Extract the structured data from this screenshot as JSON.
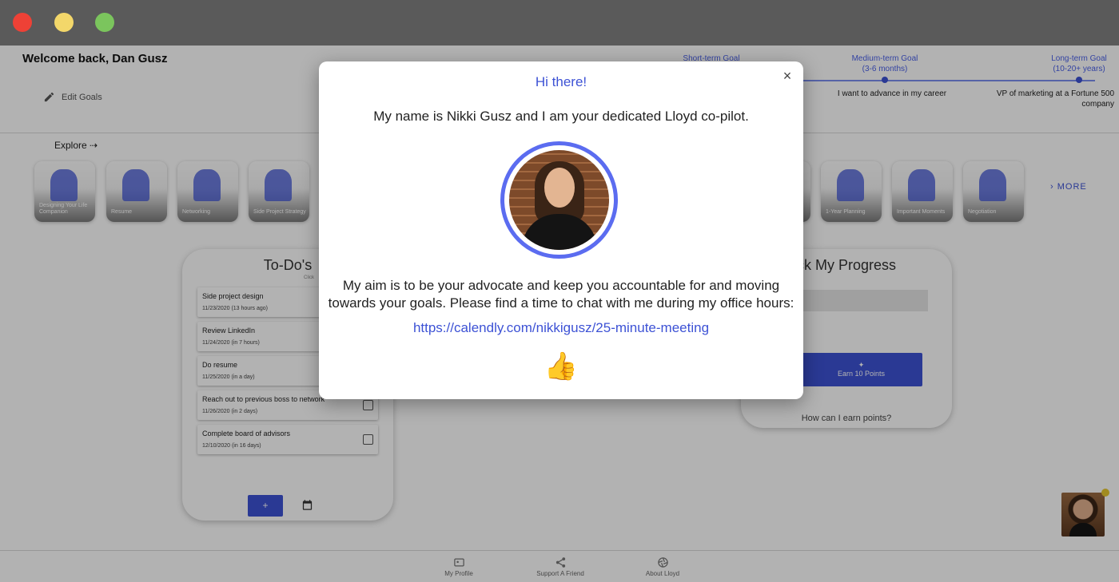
{
  "window": {
    "controls": [
      "close",
      "minimize",
      "maximize"
    ]
  },
  "header": {
    "welcome": "Welcome back, Dan Gusz",
    "edit_goals": "Edit Goals",
    "goals": {
      "short_term": {
        "label": "Short-term Goal"
      },
      "medium_term": {
        "label": "Medium-term Goal",
        "range": "(3-6 months)",
        "description": "I want to advance in my career"
      },
      "long_term": {
        "label": "Long-term Goal",
        "range": "(10-20+ years)",
        "description": "VP of marketing at a Fortune 500 company"
      }
    }
  },
  "explore": {
    "label": "Explore ⇢",
    "more": "MORE",
    "tiles": [
      {
        "label": "Designing Your Life Companion",
        "icon": "companion-illustration"
      },
      {
        "label": "Resume",
        "icon": "resume-illustration"
      },
      {
        "label": "Networking",
        "icon": "networking-illustration"
      },
      {
        "label": "Side Project Strategy",
        "icon": "side-project-illustration"
      },
      {
        "label": "",
        "icon": "career-illustration"
      },
      {
        "label": "1-Year Planning",
        "icon": "planning-illustration"
      },
      {
        "label": "Important Moments",
        "icon": "moments-illustration"
      },
      {
        "label": "Negotiation",
        "icon": "negotiation-illustration"
      }
    ]
  },
  "todos": {
    "title": "To-Do's",
    "hint": "Click",
    "items": [
      {
        "title": "Side project design",
        "date": "11/23/2020 (13 hours ago)"
      },
      {
        "title": "Review LinkedIn",
        "date": "11/24/2020 (in 7 hours)"
      },
      {
        "title": "Do resume",
        "date": "11/25/2020 (in a day)"
      },
      {
        "title": "Reach out to previous boss to network",
        "date": "11/26/2020 (in 2 days)"
      },
      {
        "title": "Complete board of advisors",
        "date": "12/10/2020 (in 16 days)"
      }
    ],
    "add_label": "+"
  },
  "progress": {
    "title": "ck My Progress",
    "fill_fraction": 0.07,
    "fill_color": "#4caf50",
    "earn_label": "Earn 10 Points",
    "how_label": "How can I earn points?"
  },
  "nav": {
    "items": [
      {
        "label": "My Profile",
        "icon": "profile-card-icon"
      },
      {
        "label": "Support A Friend",
        "icon": "share-icon"
      },
      {
        "label": "About Lloyd",
        "icon": "aperture-icon"
      }
    ]
  },
  "modal": {
    "title": "Hi there!",
    "intro": "My name is Nikki Gusz and I am your dedicated Lloyd co-pilot.",
    "aim_line1": "My aim is to be your advocate and keep you accountable for and moving",
    "aim_line2": "towards your goals. Please find a time to chat with me during my office hours:",
    "link": "https://calendly.com/nikkigusz/25-minute-meeting",
    "close": "×",
    "emoji": "👍"
  },
  "colors": {
    "accent": "#3d52d5",
    "titlebar": "#5a5a5a",
    "close_light": "#ee4136",
    "minimize_light": "#f3d76a",
    "maximize_light": "#7bc55d",
    "avatar_ring": "#5b6cf0"
  }
}
